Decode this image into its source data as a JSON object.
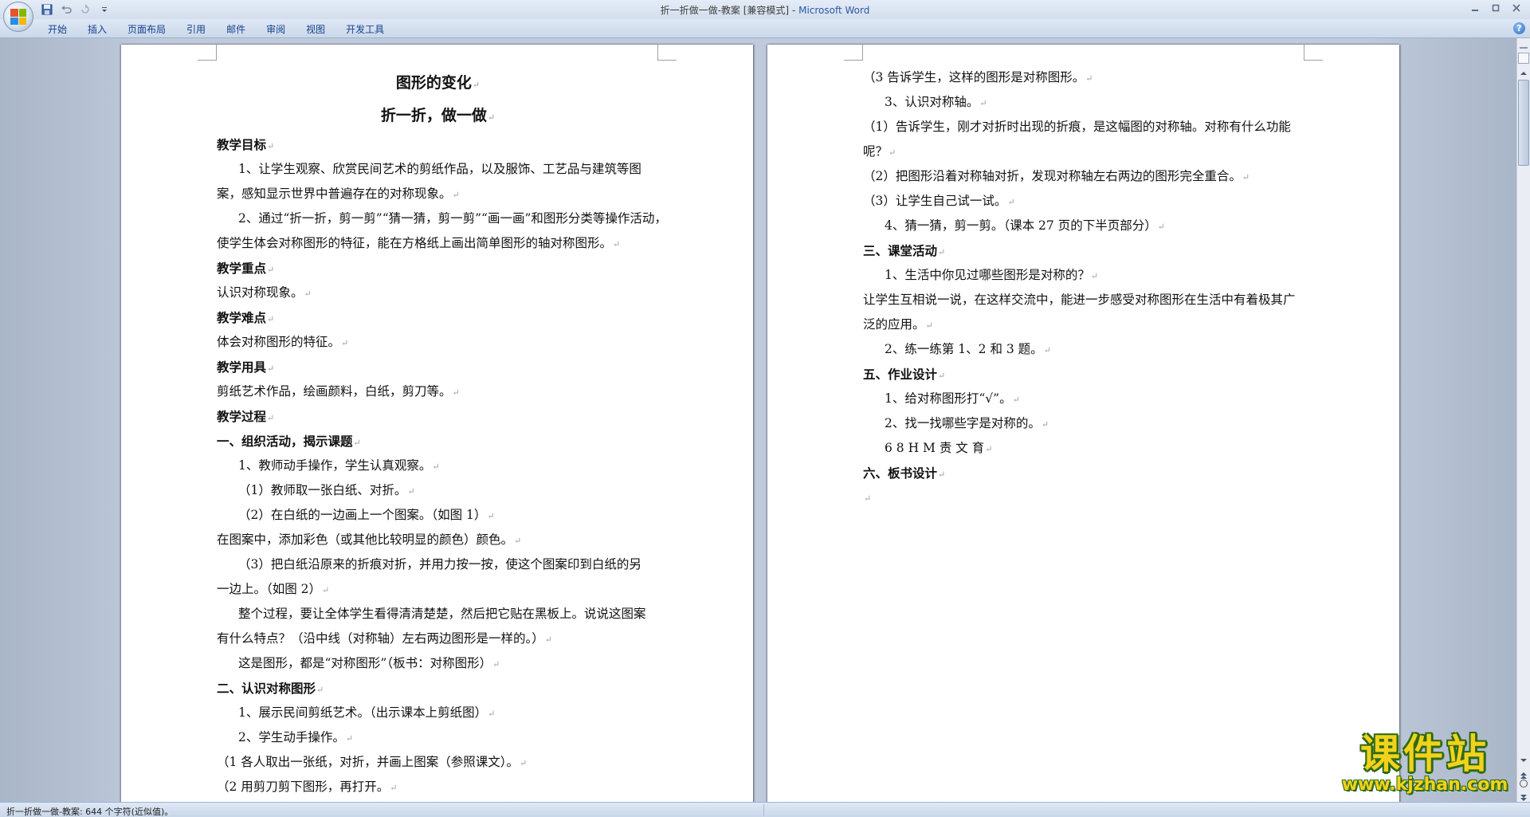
{
  "window": {
    "title_doc": "折一折做一做-教案 [兼容模式]",
    "title_sep": " - ",
    "title_app": "Microsoft Word"
  },
  "ribbon": {
    "tabs": [
      "开始",
      "插入",
      "页面布局",
      "引用",
      "邮件",
      "审阅",
      "视图",
      "开发工具"
    ]
  },
  "colors": {
    "ribbon_text": "#15428b",
    "paragraph_mark": "#9aa0a6",
    "watermark_fill": "#f3d21b",
    "watermark_outline": "#2e6b16"
  },
  "paragraph_mark": "↵",
  "page_left": {
    "lines": [
      {
        "text": "图形的变化",
        "style": "ctr"
      },
      {
        "text": "折一折，做一做",
        "style": "ctr"
      },
      {
        "text": "教学目标",
        "style": "b"
      },
      {
        "text": "1、让学生观察、欣赏民间艺术的剪纸作品，以及服饰、工艺品与建筑等图",
        "style": "ind",
        "nomark": true
      },
      {
        "text": "案，感知显示世界中普遍存在的对称现象。",
        "style": ""
      },
      {
        "text": "2、通过“折一折，剪一剪”“猜一猜，剪一剪”“画一画”和图形分类等操作活动，",
        "style": "ind",
        "nomark": true
      },
      {
        "text": "使学生体会对称图形的特征，能在方格纸上画出简单图形的轴对称图形。",
        "style": ""
      },
      {
        "text": "教学重点",
        "style": "b"
      },
      {
        "text": "认识对称现象。",
        "style": ""
      },
      {
        "text": "教学难点",
        "style": "b"
      },
      {
        "text": "体会对称图形的特征。",
        "style": ""
      },
      {
        "text": "教学用具",
        "style": "b"
      },
      {
        "text": "剪纸艺术作品，绘画颜料，白纸，剪刀等。",
        "style": ""
      },
      {
        "text": "教学过程",
        "style": "b"
      },
      {
        "text": "一、组织活动，揭示课题",
        "style": "b"
      },
      {
        "text": "1、教师动手操作，学生认真观察。",
        "style": "ind"
      },
      {
        "text": "（1）教师取一张白纸、对折。",
        "style": "ind"
      },
      {
        "text": "（2）在白纸的一边画上一个图案。（如图 1）",
        "style": "ind"
      },
      {
        "text": "在图案中，添加彩色（或其他比较明显的颜色）颜色。",
        "style": ""
      },
      {
        "text": "（3）把白纸沿原来的折痕对折，并用力按一按，使这个图案印到白纸的另",
        "style": "ind",
        "nomark": true
      },
      {
        "text": "一边上。（如图 2）",
        "style": ""
      },
      {
        "text": "整个过程，要让全体学生看得清清楚楚，然后把它贴在黑板上。说说这图案",
        "style": "ind",
        "nomark": true
      },
      {
        "text": "有什么特点？（沿中线（对称轴）左右两边图形是一样的。）",
        "style": ""
      },
      {
        "text": "这是图形，都是“对称图形”（板书：对称图形）",
        "style": "ind"
      },
      {
        "text": "二、认识对称图形",
        "style": "b"
      },
      {
        "text": "1、展示民间剪纸艺术。（出示课本上剪纸图）",
        "style": "ind"
      },
      {
        "text": "2、学生动手操作。",
        "style": "ind"
      },
      {
        "text": "（1 各人取出一张纸，对折，并画上图案（参照课文）。",
        "style": ""
      },
      {
        "text": "（2 用剪刀剪下图形，再打开。",
        "style": ""
      }
    ]
  },
  "page_right": {
    "lines": [
      {
        "text": "（3 告诉学生，这样的图形是对称图形。",
        "style": ""
      },
      {
        "text": "3、认识对称轴。",
        "style": "ind"
      },
      {
        "text": "（1）告诉学生，刚才对折时出现的折痕，是这幅图的对称轴。对称有什么功能",
        "style": "",
        "nomark": true
      },
      {
        "text": "呢？",
        "style": ""
      },
      {
        "text": "（2）把图形沿着对称轴对折，发现对称轴左右两边的图形完全重合。",
        "style": ""
      },
      {
        "text": "（3）让学生自己试一试。",
        "style": ""
      },
      {
        "text": "4、猜一猜，剪一剪。（课本 27 页的下半页部分）",
        "style": "ind"
      },
      {
        "text": "三、课堂活动",
        "style": "b"
      },
      {
        "text": "1、生活中你见过哪些图形是对称的？",
        "style": "ind"
      },
      {
        "text": "让学生互相说一说，在这样交流中，能进一步感受对称图形在生活中有着极其广",
        "style": "",
        "nomark": true
      },
      {
        "text": "泛的应用。",
        "style": ""
      },
      {
        "text": "2、练一练第 1、2 和 3 题。",
        "style": "ind"
      },
      {
        "text": "五、作业设计",
        "style": "b"
      },
      {
        "text": "1、给对称图形打“√”。",
        "style": "ind"
      },
      {
        "text": "2、找一找哪些字是对称的。",
        "style": "ind"
      },
      {
        "text": "6  8  H  M  责  文  育",
        "style": "ind"
      },
      {
        "text": "六、板书设计",
        "style": "b"
      },
      {
        "text": "",
        "style": ""
      }
    ]
  },
  "statusbar": {
    "text": "折一折做一做-教案: 644 个字符(近似值)。"
  },
  "watermark": {
    "title": "课件站",
    "url": "www.kjzhan.com"
  }
}
